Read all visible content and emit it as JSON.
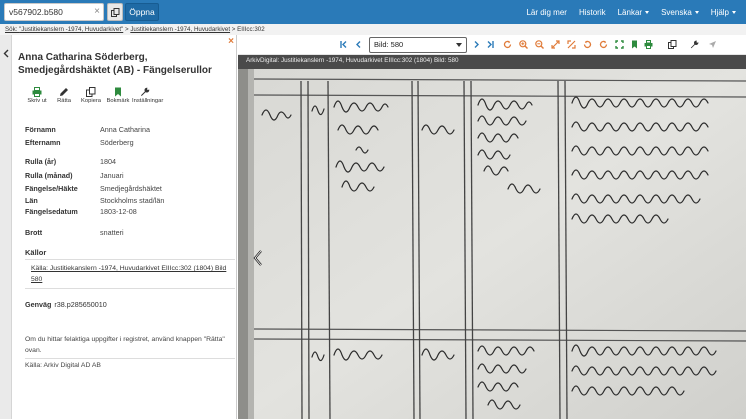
{
  "topbar": {
    "search_value": "v567902.b580",
    "clear_icon": "×",
    "open_label": "Öppna",
    "links": [
      {
        "label": "Lär dig mer",
        "dropdown": false
      },
      {
        "label": "Historik",
        "dropdown": false
      },
      {
        "label": "Länkar",
        "dropdown": true
      },
      {
        "label": "Svenska",
        "dropdown": true
      },
      {
        "label": "Hjälp",
        "dropdown": true
      }
    ]
  },
  "breadcrumb": {
    "prefix": "Sök: ",
    "crumb1": "\"Justitiekanslern -1974, Huvudarkivet\"",
    "sep1": " > ",
    "crumb2": "Justitiekanslern -1974, Huvudarkivet",
    "sep2": " > ",
    "current": "EIIIcc:302"
  },
  "panel": {
    "close_icon": "×",
    "title": "Anna Catharina Söderberg, Smedjegårdshäktet (AB) - Fängelserullor",
    "tools": [
      {
        "label": "Skriv ut",
        "icon": "printer-icon"
      },
      {
        "label": "Rätta",
        "icon": "pencil-icon"
      },
      {
        "label": "Kopiera",
        "icon": "copy-icon"
      },
      {
        "label": "Bokmärk",
        "icon": "bookmark-icon"
      },
      {
        "label": "Inställningar",
        "icon": "wrench-icon"
      }
    ],
    "fields": [
      {
        "label": "Förnamn",
        "value": "Anna Catharina"
      },
      {
        "label": "Efternamn",
        "value": "Söderberg"
      },
      {
        "label": "Rulla (år)",
        "value": "1804"
      },
      {
        "label": "Rulla (månad)",
        "value": "Januari"
      },
      {
        "label": "Fängelse/Häkte",
        "value": "Smedjegårdshäktet"
      },
      {
        "label": "Län",
        "value": "Stockholms stad/län"
      },
      {
        "label": "Fängelsedatum",
        "value": "1803-12-08"
      },
      {
        "label": "Brott",
        "value": "snatteri"
      }
    ],
    "sources_heading": "Källor",
    "source_link": "Källa: Justitiekanslern -1974, Huvudarkivet EIIIcc:302 (1804) Bild 580",
    "shortcut_label": "Genväg",
    "shortcut_value": "r38.p285650010",
    "note": "Om du hittar felaktiga uppgifter i registret, använd knappen \"Rätta\" ovan.",
    "credit": "Källa: Arkiv Digital AD AB"
  },
  "viewer": {
    "image_select": "Bild: 580",
    "caption": "ArkivDigital: Justitiekanslern -1974, Huvudarkivet EIIIcc:302 (1804) Bild: 580"
  },
  "colors": {
    "topbar": "#2a7ab8",
    "accent_orange": "#e07b39",
    "accent_green": "#2e8b3e",
    "accent_blue": "#2a7ab8"
  }
}
